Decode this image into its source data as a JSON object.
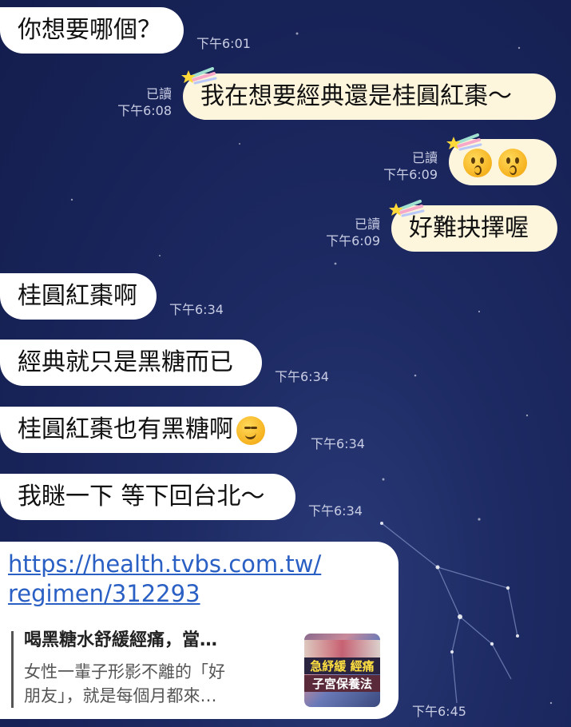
{
  "colors": {
    "background": "#1a2459",
    "incoming_bubble": "#ffffff",
    "outgoing_bubble": "#fdf5dc",
    "link": "#2a5fc4",
    "meta_text": "#c9cde3"
  },
  "messages": [
    {
      "dir": "in",
      "text": "你想要哪個？",
      "time": "下午6:01"
    },
    {
      "dir": "out",
      "text": "我在想要經典還是桂圓紅棗～",
      "read": "已讀",
      "time": "下午6:08"
    },
    {
      "dir": "out",
      "emojis": [
        "kissing-face-icon",
        "kissing-face-icon"
      ],
      "read": "已讀",
      "time": "下午6:09"
    },
    {
      "dir": "out",
      "text": "好難抉擇喔",
      "read": "已讀",
      "time": "下午6:09"
    },
    {
      "dir": "in",
      "text": "桂圓紅棗啊",
      "time": "下午6:34"
    },
    {
      "dir": "in",
      "text": "經典就只是黑糖而已",
      "time": "下午6:34"
    },
    {
      "dir": "in",
      "text": "桂圓紅棗也有黑糖啊",
      "emoji": "smirking-face-icon",
      "time": "下午6:34"
    },
    {
      "dir": "in",
      "text": "我瞇一下 等下回台北～",
      "time": "下午6:34"
    }
  ],
  "link_message": {
    "url_line1": "https://health.tvbs.com.tw/",
    "url_line2": "regimen/312293",
    "preview_title": "喝黑糖水舒緩經痛，當…",
    "preview_desc_line1": "女性一輩子形影不離的「好",
    "preview_desc_line2": "朋友」，就是每個月都來…",
    "thumb_text1": "急紓緩 經痛",
    "thumb_text2": "子宮保養法",
    "time": "下午6:45"
  }
}
